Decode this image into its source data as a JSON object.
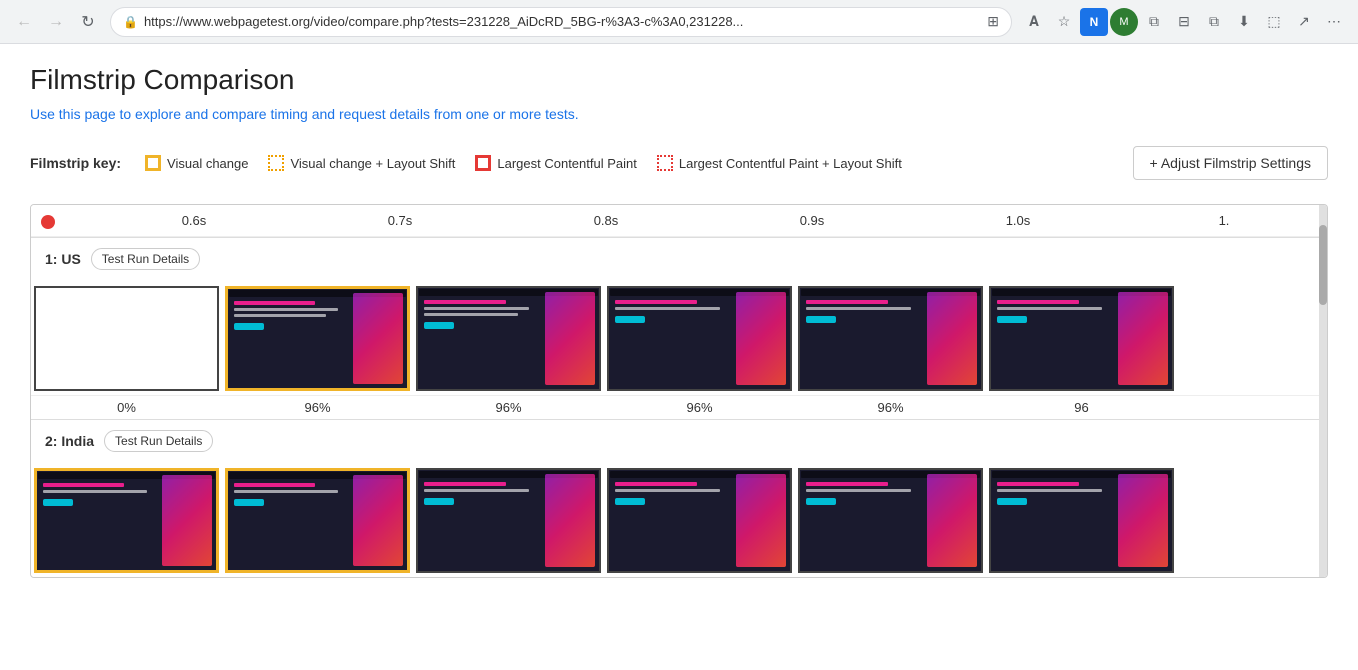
{
  "browser": {
    "url": "https://www.webpagetest.org/video/compare.php?tests=231228_AiDcRD_5BG-r%3A3-c%3A0,231228...",
    "back_disabled": true,
    "forward_disabled": true
  },
  "page": {
    "title": "Filmstrip Comparison",
    "subtitle": "Use this page to explore and compare timing and request details from one or more tests."
  },
  "filmstrip_key": {
    "label": "Filmstrip key:",
    "items": [
      {
        "id": "visual-change",
        "type": "solid-yellow",
        "label": "Visual change"
      },
      {
        "id": "visual-change-layout-shift",
        "type": "dotted-orange",
        "label": "Visual change + Layout Shift"
      },
      {
        "id": "largest-contentful-paint",
        "type": "solid-red",
        "label": "Largest Contentful Paint"
      },
      {
        "id": "largest-contentful-paint-layout-shift",
        "type": "dotted-red",
        "label": "Largest Contentful Paint + Layout Shift"
      }
    ],
    "adjust_button": "+ Adjust Filmstrip Settings"
  },
  "timeline": {
    "ticks": [
      "0.6s",
      "0.7s",
      "0.8s",
      "0.9s",
      "1.0s",
      "1."
    ]
  },
  "test_rows": [
    {
      "id": "row-1",
      "label": "1: US",
      "details_button": "Test Run Details",
      "frames": [
        {
          "id": "f1-1",
          "bg": "white",
          "border": "normal",
          "percent": "0%"
        },
        {
          "id": "f1-2",
          "bg": "dark",
          "border": "yellow",
          "percent": "96%"
        },
        {
          "id": "f1-3",
          "bg": "dark",
          "border": "normal",
          "percent": "96%"
        },
        {
          "id": "f1-4",
          "bg": "dark",
          "border": "normal",
          "percent": "96%"
        },
        {
          "id": "f1-5",
          "bg": "dark",
          "border": "normal",
          "percent": "96%"
        },
        {
          "id": "f1-6",
          "bg": "dark",
          "border": "normal",
          "percent": "96"
        }
      ]
    },
    {
      "id": "row-2",
      "label": "2: India",
      "details_button": "Test Run Details",
      "frames": [
        {
          "id": "f2-1",
          "bg": "dark",
          "border": "yellow",
          "percent": ""
        },
        {
          "id": "f2-2",
          "bg": "dark",
          "border": "yellow",
          "percent": ""
        },
        {
          "id": "f2-3",
          "bg": "dark",
          "border": "normal",
          "percent": ""
        },
        {
          "id": "f2-4",
          "bg": "dark",
          "border": "normal",
          "percent": ""
        },
        {
          "id": "f2-5",
          "bg": "dark",
          "border": "normal",
          "percent": ""
        },
        {
          "id": "f2-6",
          "bg": "dark",
          "border": "normal",
          "percent": ""
        }
      ]
    }
  ]
}
